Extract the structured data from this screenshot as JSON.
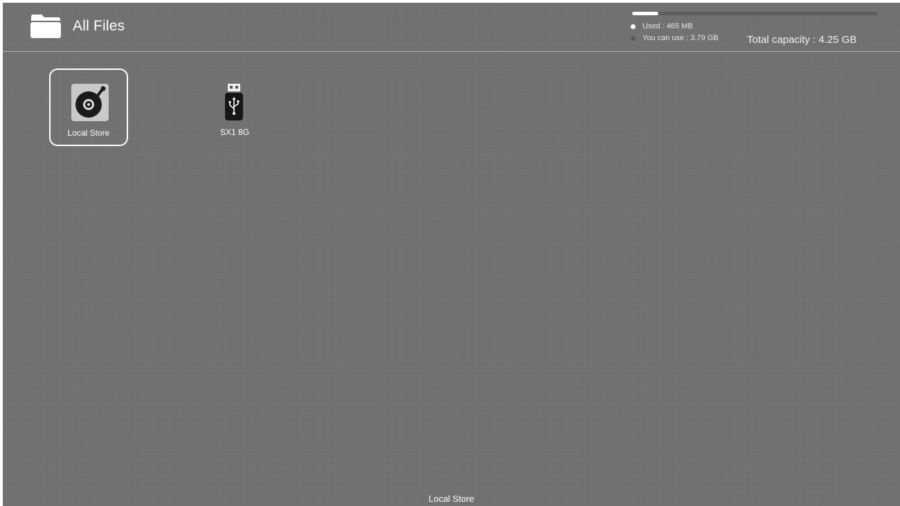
{
  "header": {
    "title": "All Files",
    "icon": "folder-icon"
  },
  "storage": {
    "used_fraction": 0.107,
    "used_label": "Used : 465 MB",
    "available_label": "You can use : 3.79 GB",
    "total_label": "Total capacity : 4.25 GB",
    "used_color": "#ffffff",
    "available_color": "#5a5a5a"
  },
  "devices": [
    {
      "label": "Local Store",
      "icon": "disc-drive-icon",
      "selected": true
    },
    {
      "label": "SX1 8G",
      "icon": "usb-drive-icon",
      "selected": false
    }
  ],
  "status": {
    "current_label": "Local Store"
  },
  "colors": {
    "background": "#717171",
    "text": "#ffffff"
  }
}
